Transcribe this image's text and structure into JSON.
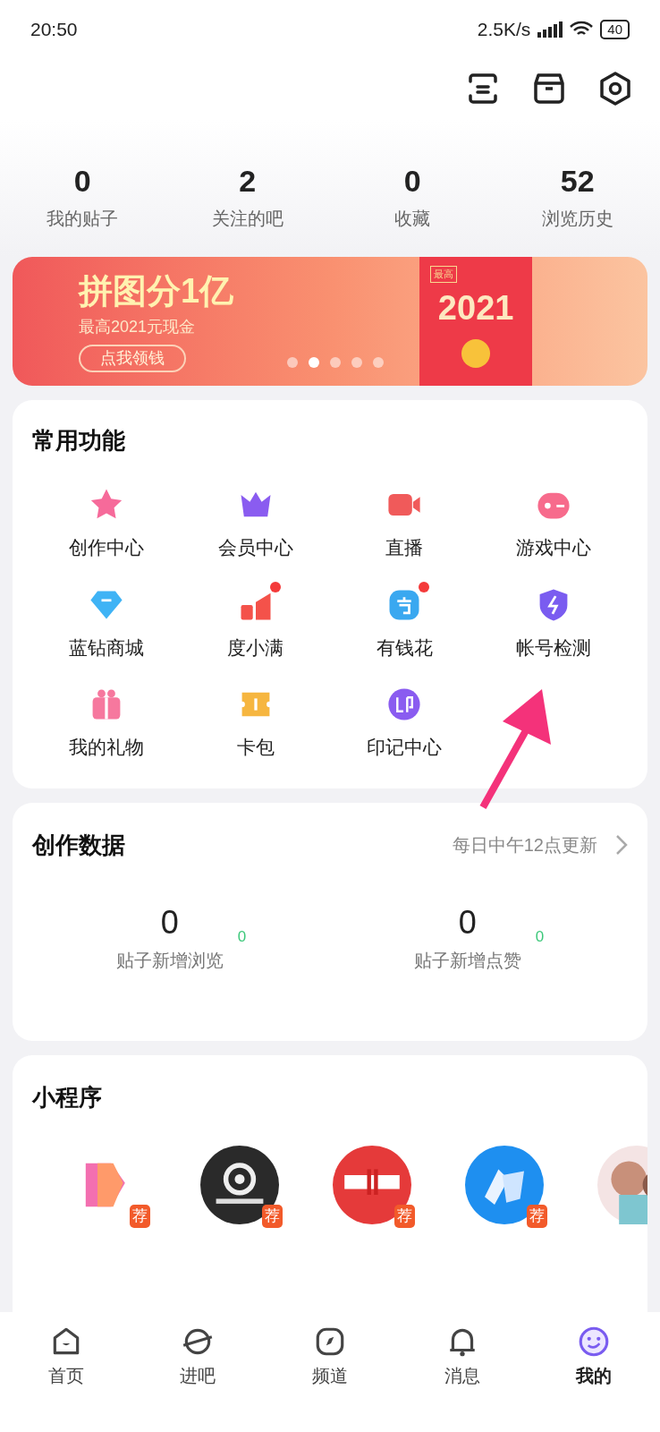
{
  "status_bar": {
    "time": "20:50",
    "speed": "2.5K/s",
    "battery": "40"
  },
  "stats": [
    {
      "value": "0",
      "label": "我的贴子"
    },
    {
      "value": "2",
      "label": "关注的吧"
    },
    {
      "value": "0",
      "label": "收藏"
    },
    {
      "value": "52",
      "label": "浏览历史"
    }
  ],
  "banner": {
    "title": "拼图分1亿",
    "subtitle": "最高2021元现金",
    "button": "点我领钱",
    "envelope_tag": "最高",
    "envelope_amount": "2021",
    "dots": [
      {
        "selected": false
      },
      {
        "selected": true
      },
      {
        "selected": false
      },
      {
        "selected": false
      },
      {
        "selected": false
      }
    ]
  },
  "common": {
    "title": "常用功能",
    "items": [
      {
        "label": "创作中心",
        "kind": "star",
        "color": "#f66a9a",
        "dot": false
      },
      {
        "label": "会员中心",
        "kind": "crown",
        "color": "#8a5cf0",
        "dot": false
      },
      {
        "label": "直播",
        "kind": "video",
        "color": "#f05a5a",
        "dot": false
      },
      {
        "label": "游戏中心",
        "kind": "gamepad",
        "color": "#f76b8c",
        "dot": false
      },
      {
        "label": "蓝钻商城",
        "kind": "diamond",
        "color": "#3fb3f5",
        "dot": false
      },
      {
        "label": "度小满",
        "kind": "bars",
        "color": "#f4524a",
        "dot": true
      },
      {
        "label": "有钱花",
        "kind": "coin",
        "color": "#3aa8f0",
        "dot": true
      },
      {
        "label": "帐号检测",
        "kind": "shield",
        "color": "#7a5cf0",
        "dot": false
      },
      {
        "label": "我的礼物",
        "kind": "gift",
        "color": "#f6789e",
        "dot": false
      },
      {
        "label": "卡包",
        "kind": "ticket",
        "color": "#f6b640",
        "dot": false
      },
      {
        "label": "印记中心",
        "kind": "seal",
        "color": "#8a5cf0",
        "dot": false
      }
    ]
  },
  "creation": {
    "title": "创作数据",
    "note": "每日中午12点更新",
    "metrics": [
      {
        "value": "0",
        "label": "贴子新增浏览",
        "delta": "0"
      },
      {
        "value": "0",
        "label": "贴子新增点赞",
        "delta": "0"
      }
    ]
  },
  "mini_programs": {
    "title": "小程序",
    "items": [
      {
        "kind": "picture",
        "badge": "荐"
      },
      {
        "kind": "picture",
        "badge": "荐"
      },
      {
        "kind": "picture",
        "badge": "荐"
      },
      {
        "kind": "picture",
        "badge": "荐"
      },
      {
        "kind": "picture"
      }
    ]
  },
  "tabs": [
    {
      "label": "首页",
      "kind": "home",
      "selected": false
    },
    {
      "label": "进吧",
      "kind": "planet",
      "selected": false
    },
    {
      "label": "频道",
      "kind": "compass",
      "selected": false
    },
    {
      "label": "消息",
      "kind": "bell",
      "selected": false
    },
    {
      "label": "我的",
      "kind": "smile",
      "selected": true
    }
  ]
}
